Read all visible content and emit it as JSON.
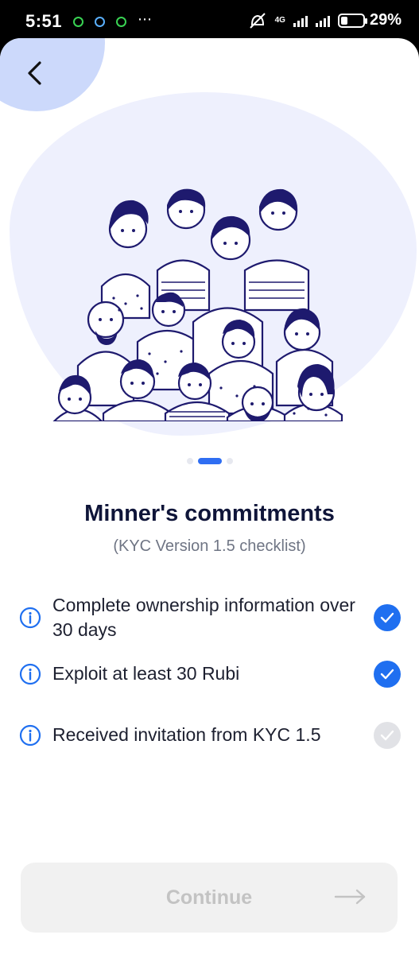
{
  "status_bar": {
    "time": "5:51",
    "network": "4G",
    "battery": "29%",
    "battery_level": 0.29,
    "more": "⋯"
  },
  "carousel": {
    "total": 3,
    "active": 1
  },
  "header": {
    "title": "Minner's commitments",
    "subtitle": "(KYC Version 1.5 checklist)"
  },
  "checklist": {
    "items": [
      {
        "label": "Complete ownership information over 30 days",
        "status": "done"
      },
      {
        "label": "Exploit at least 30 Rubi",
        "status": "done"
      },
      {
        "label": "Received invitation from KYC 1.5",
        "status": "pending"
      }
    ]
  },
  "footer": {
    "continue_label": "Continue",
    "arrow_icon": "arrow-right-icon"
  },
  "colors": {
    "accent": "#1f6ff0",
    "title": "#0f1539",
    "illustration": "#1e1a6e",
    "hero_bg": "#eef0fd"
  }
}
